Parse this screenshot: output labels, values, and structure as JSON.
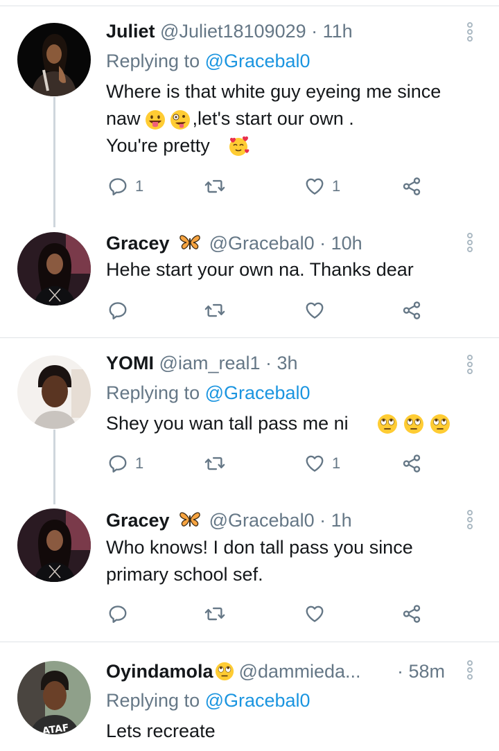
{
  "tweets": [
    {
      "name": "Juliet",
      "handle": "@Juliet18109029 · 11h",
      "replying_prefix": "Replying to ",
      "replying_to": "@Gracebal0",
      "lines": [
        "Where is that white guy eyeing me since",
        "naw          ,let's start our own .",
        "You're pretty"
      ],
      "reply_count": "1",
      "retweet_count": "",
      "like_count": "1"
    },
    {
      "name": "Gracey",
      "handle": "@Gracebal0 · 10h",
      "lines": [
        "Hehe start your own na.  Thanks dear"
      ],
      "reply_count": "",
      "retweet_count": "",
      "like_count": ""
    },
    {
      "name": "YOMI",
      "handle": "@iam_real1 · 3h",
      "replying_prefix": "Replying to ",
      "replying_to": "@Gracebal0",
      "lines": [
        "Shey you wan tall pass me ni"
      ],
      "reply_count": "1",
      "retweet_count": "",
      "like_count": "1"
    },
    {
      "name": "Gracey",
      "handle": "@Gracebal0 · 1h",
      "lines": [
        "Who knows! I don tall pass you since",
        "primary school sef."
      ],
      "reply_count": "",
      "retweet_count": "",
      "like_count": ""
    },
    {
      "name": "Oyindamola",
      "handle": "@dammieda...",
      "time": "· 58m",
      "replying_prefix": "Replying to ",
      "replying_to": "@Gracebal0",
      "lines": [
        "Lets recreate"
      ]
    }
  ],
  "icons": {
    "reply": "reply-icon",
    "retweet": "retweet-icon",
    "like": "heart-icon",
    "share": "share-icon",
    "more": "more-options-icon",
    "butterfly": "butterfly-emoji",
    "tongue": "tongue-out-emoji",
    "zany": "zany-face-emoji",
    "heart_face": "smiling-face-with-hearts-emoji",
    "eye_roll": "eye-roll-emoji"
  },
  "colors": {
    "text": "#14171a",
    "secondary": "#657786",
    "link": "#1b95e0",
    "divider": "#dfe3e6",
    "thread_line": "#cfd6dc"
  }
}
